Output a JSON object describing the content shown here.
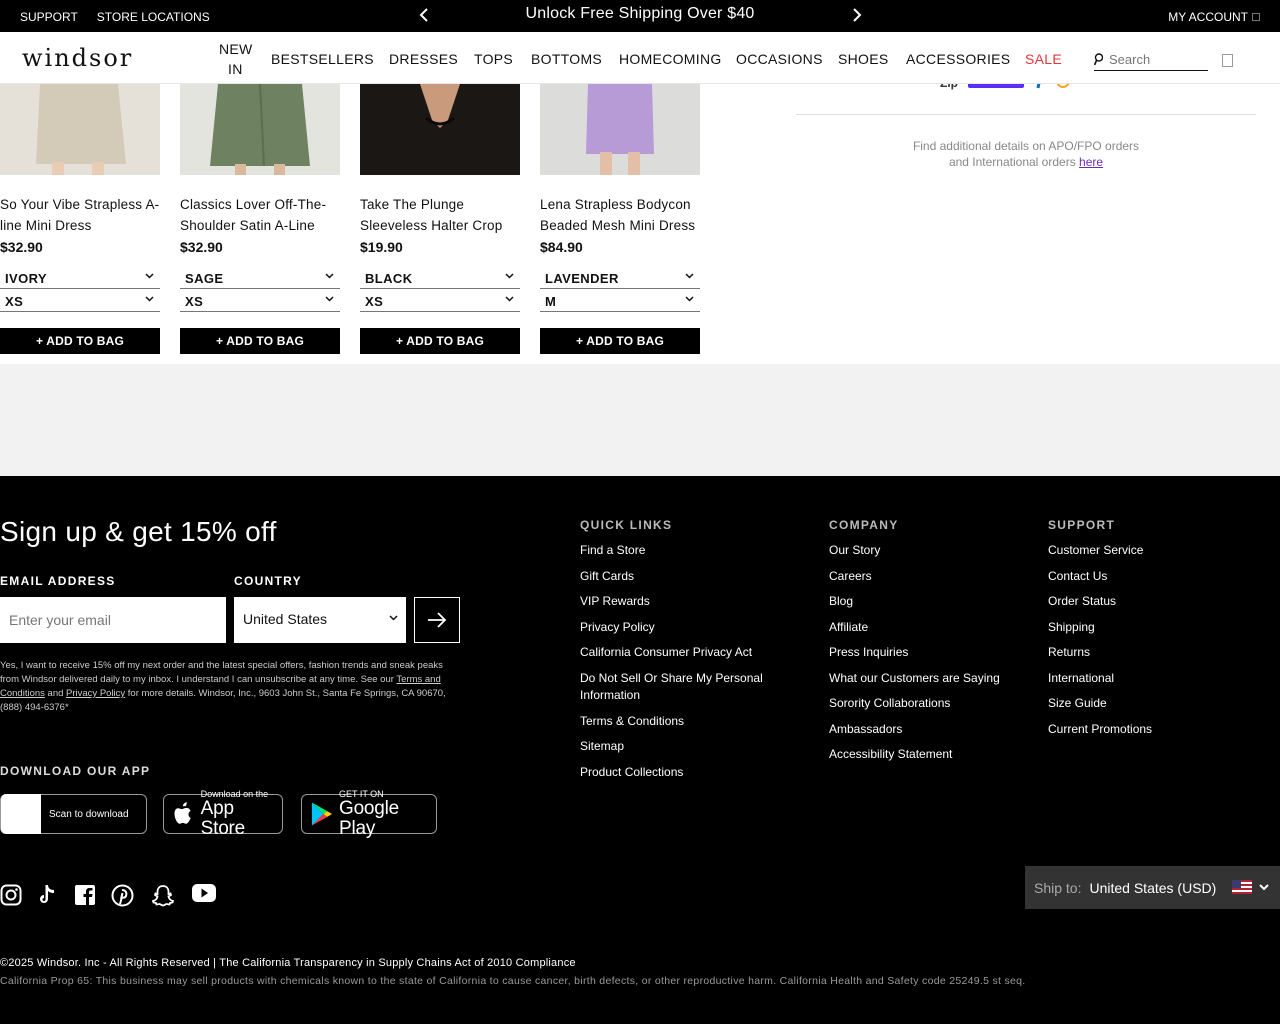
{
  "promo": {
    "links": [
      "SUPPORT",
      "STORE LOCATIONS"
    ],
    "message": "Unlock Free Shipping Over $40",
    "account_label": "MY ACCOUNT"
  },
  "header": {
    "logo": "windsor",
    "nav": {
      "new_in_1": "NEW",
      "new_in_2": "IN",
      "bestsellers": "BESTSELLERS",
      "dresses": "DRESSES",
      "tops": "TOPS",
      "bottoms": "BOTTOMS",
      "homecoming": "HOMECOMING",
      "occasions": "OCCASIONS",
      "shoes": "SHOES",
      "accessories": "ACCESSORIES",
      "sale": "SALE"
    },
    "search_placeholder": "Search"
  },
  "products": [
    {
      "name": "So Your Vibe Strapless A-line Mini Dress",
      "price": "$32.90",
      "color": "IVORY",
      "size": "XS",
      "button": "+ ADD TO BAG",
      "img_color": "#d9d2c3"
    },
    {
      "name": "Classics Lover Off-The-Shoulder Satin A-Line",
      "price": "$32.90",
      "color": "SAGE",
      "size": "XS",
      "button": "+ ADD TO BAG",
      "img_color": "#6f8463"
    },
    {
      "name": "Take The Plunge Sleeveless Halter Crop",
      "price": "$19.90",
      "color": "BLACK",
      "size": "XS",
      "button": "+ ADD TO BAG",
      "img_color": "#1a1614"
    },
    {
      "name": "Lena Strapless Bodycon Beaded Mesh Mini Dress",
      "price": "$84.90",
      "color": "LAVENDER",
      "size": "M",
      "button": "+ ADD TO BAG",
      "img_color": "#b89bd8"
    }
  ],
  "shipping_panel": {
    "pay_prefix": "Zip",
    "note_line1": "Find additional details on APO/FPO orders",
    "note_line2": "and International orders",
    "link": "here"
  },
  "footer": {
    "signup_title": "Sign up & get 15% off",
    "email_label": "EMAIL ADDRESS",
    "email_placeholder": "Enter your email",
    "country_label": "COUNTRY",
    "country_value": "United States",
    "legal_1": "Yes, I want to receive 15% off my next order and the latest special offers, fashion trends and sneak peaks from Windsor delivered daily to my inbox. I understand I can unsubscribe at any time. See our",
    "legal_terms": "Terms and Conditions",
    "legal_and": "and",
    "legal_privacy": "Privacy Policy",
    "legal_2": "for more details. Windsor, Inc., 9603 John St., Santa Fe Springs, CA 90670, (888) 494-6376*",
    "app_label": "DOWNLOAD OUR APP",
    "scan_label": "Scan to download",
    "appstore_small": "Download on the",
    "appstore_big": "App Store",
    "gplay_small": "GET IT ON",
    "gplay_big": "Google Play",
    "quick_links_title": "QUICK LINKS",
    "quick_links": [
      "Find a Store",
      "Gift Cards",
      "VIP Rewards",
      "Privacy Policy",
      "California Consumer Privacy Act",
      "Do Not Sell Or Share My Personal Information",
      "Terms & Conditions",
      "Sitemap",
      "Product Collections"
    ],
    "company_title": "COMPANY",
    "company_links": [
      "Our Story",
      "Careers",
      "Blog",
      "Affiliate",
      "Press Inquiries",
      "What our Customers are Saying",
      "Sorority Collaborations",
      "Ambassadors",
      "Accessibility Statement"
    ],
    "support_title": "SUPPORT",
    "support_links": [
      "Customer Service",
      "Contact Us",
      "Order Status",
      "Shipping",
      "Returns",
      "International",
      "Size Guide",
      "Current Promotions"
    ],
    "ship_to_label": "Ship to:",
    "ship_to_value": "United States (USD)",
    "copyright": "©2025 Windsor. Inc - All Rights Reserved | The California Transparency in Supply Chains Act of 2010 Compliance",
    "prop65": "California Prop 65: This business may sell products with chemicals known to the state of California to cause cancer, birth defects, or other reproductive harm. California Health and Safety code 25249.5 st seq."
  }
}
